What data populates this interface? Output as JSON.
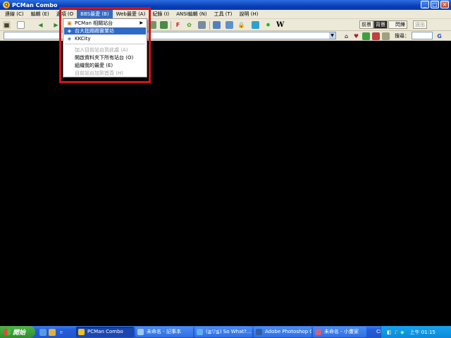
{
  "window": {
    "title": "PCMan Combo",
    "controls": [
      "_",
      "□",
      "×"
    ]
  },
  "menubar": {
    "items": [
      {
        "label": "連線 (C)"
      },
      {
        "label": "編輯 (E)"
      },
      {
        "label": "選項 (O"
      },
      {
        "label": "BBS最愛 (B)"
      },
      {
        "label": "Web最愛 (A)"
      },
      {
        "label": "紀錄 (I)"
      },
      {
        "label": "ANSI編輯 (N)"
      },
      {
        "label": "工具 (T)"
      },
      {
        "label": "說明 (H)"
      }
    ]
  },
  "dropdown": {
    "items": [
      {
        "label": "PCMan 相關站台",
        "icon": "folder-icon",
        "has_submenu": true,
        "disabled": false,
        "selected": false
      },
      {
        "label": "台大批踢踢實業坊",
        "icon": "bbs-site-icon",
        "has_submenu": false,
        "disabled": false,
        "selected": true
      },
      {
        "label": "KKCity",
        "icon": "bbs-site-icon",
        "has_submenu": false,
        "disabled": false,
        "selected": false
      },
      {
        "label": "加入目前站台到此處 (A)",
        "disabled": true
      },
      {
        "label": "開啟資料夾下所有站台 (O)",
        "disabled": false
      },
      {
        "label": "組織我的最愛 (E)",
        "disabled": false
      },
      {
        "label": "目前站台加到首頁 (H)",
        "disabled": true
      }
    ]
  },
  "toolbar": {
    "text_buttons": [
      "前景",
      "背景",
      "閃爍",
      "送出"
    ],
    "search_label": "搜尋：",
    "letter_buttons": [
      "F",
      "W"
    ]
  },
  "taskbar": {
    "start_label": "開始",
    "tasks": [
      {
        "label": "PCMan Combo",
        "active": true
      },
      {
        "label": "未命名 - 記事本",
        "active": false
      },
      {
        "label": "(≧▽≦) So What?...",
        "active": false
      },
      {
        "label": "Adobe Photoshop C...",
        "active": false
      },
      {
        "label": "未命名 - 小畫家",
        "active": false
      }
    ],
    "language": "CH",
    "clock": "上午 01:15"
  },
  "colors": {
    "highlight_border": "#d0141c",
    "menu_selected": "#316ac5",
    "terminal_bg": "#000000"
  }
}
